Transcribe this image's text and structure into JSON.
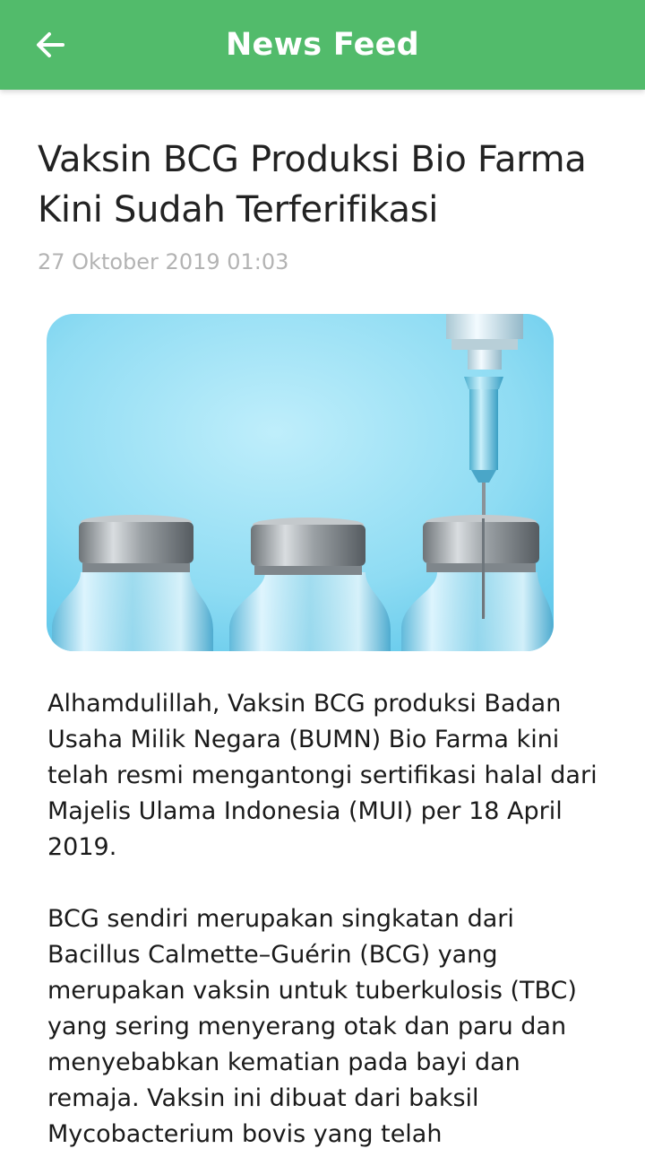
{
  "appbar": {
    "title": "News Feed",
    "back_icon": "arrow-left-icon",
    "background_color": "#52bb6b"
  },
  "article": {
    "title": "Vaksin BCG Produksi Bio Farma Kini Sudah Terferifikasi",
    "date": "27 Oktober 2019 01:03",
    "image_icon": "vaccine-vials-photo",
    "paragraphs": [
      "Alhamdulillah, Vaksin BCG produksi Badan Usaha Milik Negara (BUMN) Bio Farma kini telah resmi mengantongi sertifikasi halal dari Majelis Ulama Indonesia (MUI) per 18 April 2019.",
      "BCG sendiri merupakan singkatan dari Bacillus Calmette–Guérin (BCG) yang merupakan vaksin untuk tuberkulosis (TBC) yang sering menyerang otak dan paru dan menyebabkan kematian pada bayi dan remaja. Vaksin ini dibuat dari baksil Mycobacterium bovis yang telah"
    ]
  }
}
